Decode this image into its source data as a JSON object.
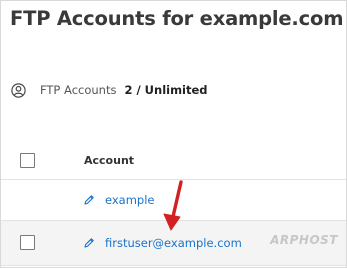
{
  "page": {
    "title": "FTP Accounts for example.com"
  },
  "quota": {
    "icon": "user-circle-icon",
    "label": "FTP Accounts",
    "value": "2 / Unlimited"
  },
  "table": {
    "columns": {
      "account": "Account"
    },
    "rows": [
      {
        "account": "example",
        "icon": "pencil-icon"
      },
      {
        "account": "firstuser@example.com",
        "icon": "pencil-icon"
      }
    ]
  },
  "annotation": {
    "arrow_color": "#d42020"
  },
  "colors": {
    "link": "#1a73c9",
    "row_highlight": "#f4f4f4"
  },
  "watermark": {
    "text": "ARPHOST"
  }
}
